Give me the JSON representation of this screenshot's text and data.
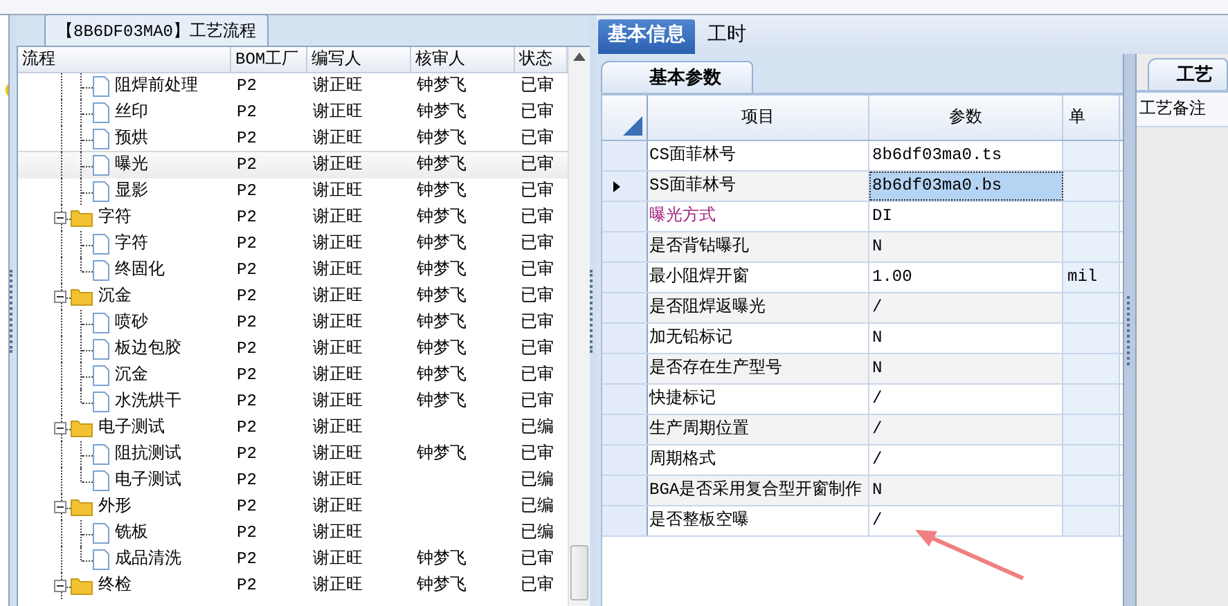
{
  "process_panel": {
    "title": "【8B6DF03MA0】工艺流程",
    "columns": [
      "流程",
      "BOM工厂",
      "编写人",
      "核审人",
      "状态"
    ],
    "tree": {
      "continued": [
        {
          "name": "阻焊前处理",
          "bom": "P2",
          "writer": "谢正旺",
          "reviewer": "钟梦飞",
          "status": "已审",
          "selected": false
        },
        {
          "name": "丝印",
          "bom": "P2",
          "writer": "谢正旺",
          "reviewer": "钟梦飞",
          "status": "已审",
          "selected": false
        },
        {
          "name": "预烘",
          "bom": "P2",
          "writer": "谢正旺",
          "reviewer": "钟梦飞",
          "status": "已审",
          "selected": false
        },
        {
          "name": "曝光",
          "bom": "P2",
          "writer": "谢正旺",
          "reviewer": "钟梦飞",
          "status": "已审",
          "selected": true
        },
        {
          "name": "显影",
          "bom": "P2",
          "writer": "谢正旺",
          "reviewer": "钟梦飞",
          "status": "已审",
          "selected": false
        }
      ],
      "nodes": [
        {
          "name": "字符",
          "bom": "P2",
          "writer": "谢正旺",
          "reviewer": "钟梦飞",
          "status": "已审",
          "selected": false,
          "expanded": true,
          "children": [
            {
              "name": "字符",
              "bom": "P2",
              "writer": "谢正旺",
              "reviewer": "钟梦飞",
              "status": "已审",
              "selected": false
            },
            {
              "name": "终固化",
              "bom": "P2",
              "writer": "谢正旺",
              "reviewer": "钟梦飞",
              "status": "已审",
              "selected": false
            }
          ]
        },
        {
          "name": "沉金",
          "bom": "P2",
          "writer": "谢正旺",
          "reviewer": "钟梦飞",
          "status": "已审",
          "selected": false,
          "expanded": true,
          "children": [
            {
              "name": "喷砂",
              "bom": "P2",
              "writer": "谢正旺",
              "reviewer": "钟梦飞",
              "status": "已审",
              "selected": false
            },
            {
              "name": "板边包胶",
              "bom": "P2",
              "writer": "谢正旺",
              "reviewer": "钟梦飞",
              "status": "已审",
              "selected": false
            },
            {
              "name": "沉金",
              "bom": "P2",
              "writer": "谢正旺",
              "reviewer": "钟梦飞",
              "status": "已审",
              "selected": false
            },
            {
              "name": "水洗烘干",
              "bom": "P2",
              "writer": "谢正旺",
              "reviewer": "钟梦飞",
              "status": "已审",
              "selected": false
            }
          ]
        },
        {
          "name": "电子测试",
          "bom": "P2",
          "writer": "谢正旺",
          "status": "已编",
          "selected": false,
          "expanded": true,
          "children": [
            {
              "name": "阻抗测试",
              "bom": "P2",
              "writer": "谢正旺",
              "reviewer": "钟梦飞",
              "status": "已审",
              "selected": false
            },
            {
              "name": "电子测试",
              "bom": "P2",
              "writer": "谢正旺",
              "status": "已编",
              "selected": false
            }
          ]
        },
        {
          "name": "外形",
          "bom": "P2",
          "writer": "谢正旺",
          "status": "已编",
          "selected": false,
          "expanded": true,
          "children": [
            {
              "name": "铣板",
              "bom": "P2",
              "writer": "谢正旺",
              "status": "已编",
              "selected": false
            },
            {
              "name": "成品清洗",
              "bom": "P2",
              "writer": "谢正旺",
              "reviewer": "钟梦飞",
              "status": "已审",
              "selected": false
            }
          ]
        },
        {
          "name": "终检",
          "bom": "P2",
          "writer": "谢正旺",
          "reviewer": "钟梦飞",
          "status": "已审",
          "selected": false,
          "expanded": true
        }
      ]
    }
  },
  "tabs": [
    {
      "label": "基本信息",
      "selected": true
    },
    {
      "label": "工时",
      "selected": false
    }
  ],
  "params_panel": {
    "tab": "基本参数",
    "columns": [
      "项目",
      "参数",
      "单"
    ],
    "rows": [
      {
        "item": "CS面菲林号",
        "value": "8b6df03ma0.ts",
        "color": "#000000",
        "selected": false
      },
      {
        "item": "SS面菲林号",
        "value": "8b6df03ma0.bs",
        "color": "#000000",
        "selected": true
      },
      {
        "item": "曝光方式",
        "value": "DI",
        "color": "#a0207e",
        "selected": false
      },
      {
        "item": "是否背钻曝孔",
        "value": "N",
        "color": "#000000",
        "selected": false
      },
      {
        "item": "最小阻焊开窗",
        "value": "1.00",
        "unit": "mil",
        "color": "#000000",
        "selected": false
      },
      {
        "item": "是否阻焊返曝光",
        "value": "/",
        "color": "#000000",
        "selected": false
      },
      {
        "item": "加无铅标记",
        "value": "N",
        "color": "#000000",
        "selected": false
      },
      {
        "item": "是否存在生产型号",
        "value": "N",
        "color": "#000000",
        "selected": false
      },
      {
        "item": "快捷标记",
        "value": "/",
        "color": "#000000",
        "selected": false
      },
      {
        "item": "生产周期位置",
        "value": "/",
        "color": "#000000",
        "selected": false
      },
      {
        "item": "周期格式",
        "value": "/",
        "color": "#000000",
        "selected": false
      },
      {
        "item": "BGA是否采用复合型开窗制作",
        "value": "N",
        "color": "#000000",
        "selected": false
      },
      {
        "item": "是否整板空曝",
        "value": "/",
        "color": "#000000",
        "selected": false
      }
    ]
  },
  "notes_panel": {
    "tab": "工艺",
    "label": "工艺备注"
  }
}
